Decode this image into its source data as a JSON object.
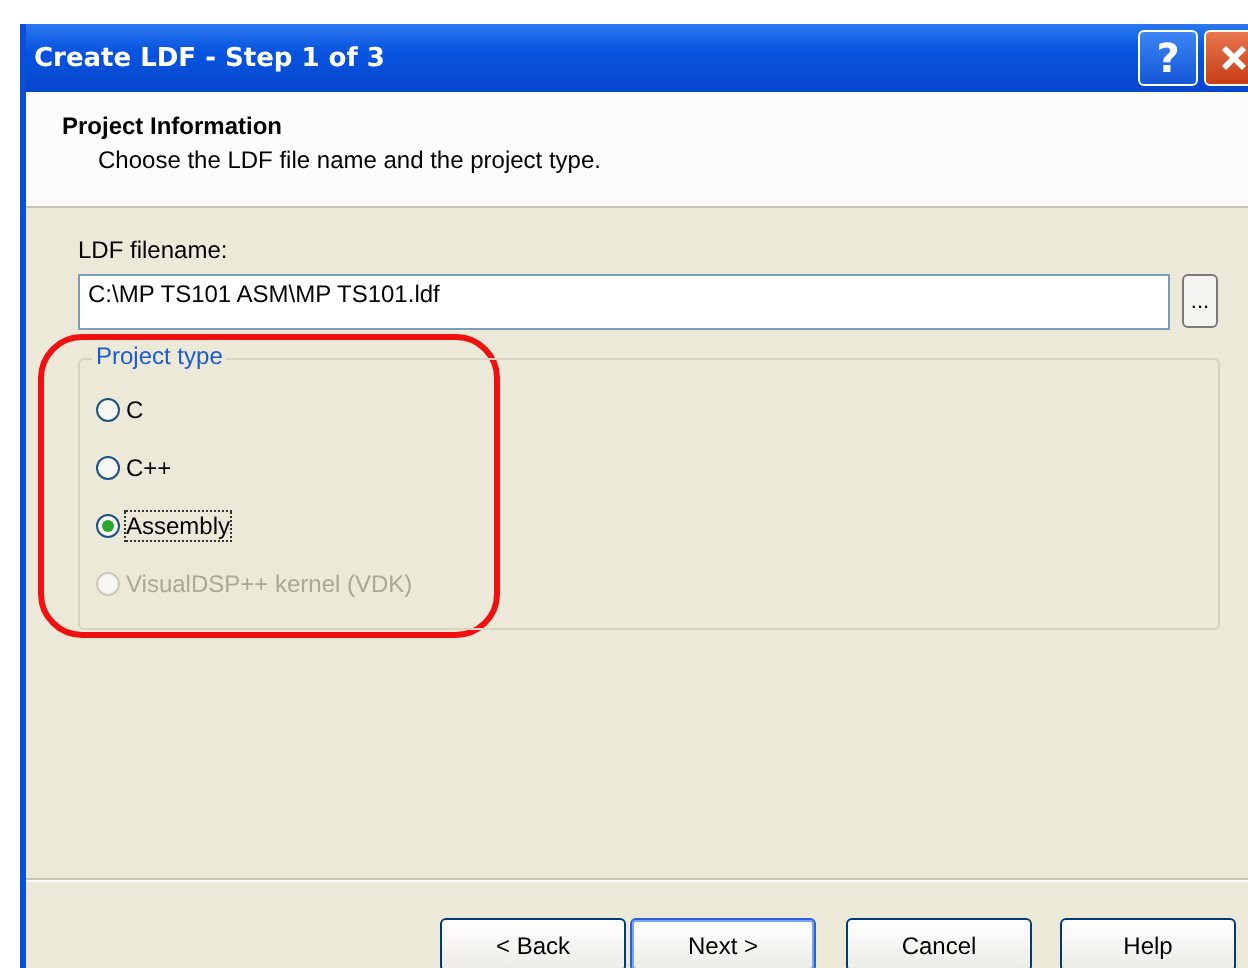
{
  "window": {
    "title": "Create LDF - Step 1 of 3",
    "title_buttons": [
      {
        "kind": "help",
        "label": "?"
      },
      {
        "kind": "close"
      }
    ]
  },
  "header": {
    "title": "Project Information",
    "subtitle": "Choose the LDF file name and the project type."
  },
  "filename": {
    "label": "LDF filename:",
    "value": "C:\\MP TS101 ASM\\MP TS101.ldf",
    "browse_label": "..."
  },
  "project_type": {
    "legend": "Project type",
    "options": [
      {
        "label": "C",
        "selected": false,
        "disabled": false
      },
      {
        "label": "C++",
        "selected": false,
        "disabled": false
      },
      {
        "label": "Assembly",
        "selected": true,
        "disabled": false
      },
      {
        "label": "VisualDSP++ kernel (VDK)",
        "selected": false,
        "disabled": true
      }
    ]
  },
  "buttons": [
    {
      "label": "< Back",
      "default": false
    },
    {
      "label": "Next >",
      "default": true
    },
    {
      "label": "Cancel",
      "default": false
    },
    {
      "label": "Help",
      "default": false
    }
  ]
}
